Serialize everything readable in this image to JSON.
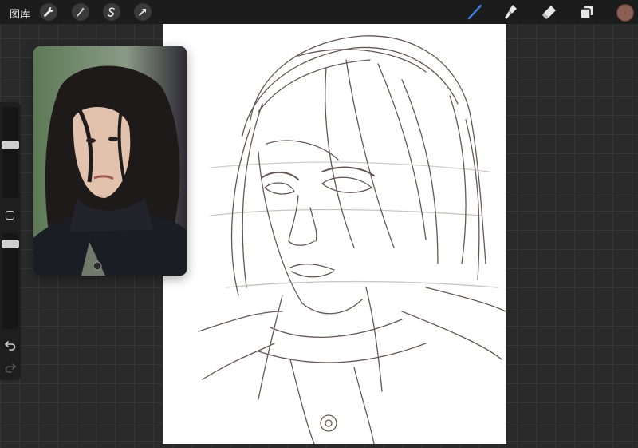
{
  "toolbar": {
    "gallery_label": "图库",
    "left_tools": [
      "wrench-icon",
      "magic-wand-icon",
      "selection-s-icon",
      "transform-arrow-icon"
    ],
    "right_tools": [
      "brush-icon",
      "smudge-icon",
      "eraser-icon",
      "layers-icon"
    ],
    "active_tool": "brush-icon",
    "active_tool_color": "#3d7de0",
    "current_color": "#8a5e52"
  },
  "sidebar": {
    "brush_size_level": 0.5,
    "opacity_level": 0.05,
    "controls": [
      "brush-size-slider",
      "modify-button",
      "opacity-slider",
      "undo-button",
      "redo-button"
    ]
  },
  "reference": {
    "content": "reference-photo"
  },
  "canvas": {
    "background": "#ffffff",
    "sketch_color": "#4a3a36"
  }
}
